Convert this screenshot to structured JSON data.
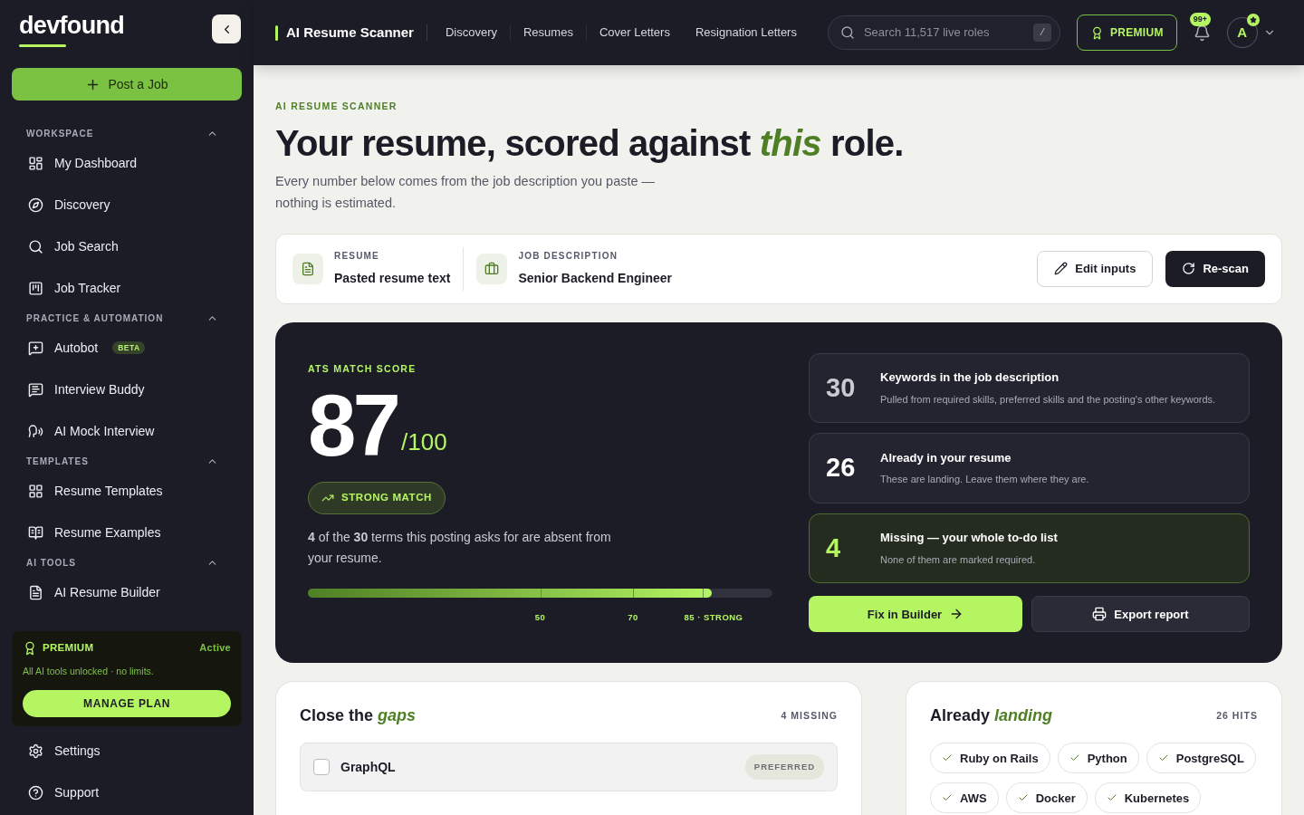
{
  "sidebar": {
    "logo": "devfound",
    "post_button": "Post a Job",
    "sections": [
      {
        "title": "WORKSPACE",
        "expanded": true,
        "items": [
          {
            "label": "My Dashboard"
          },
          {
            "label": "Discovery"
          },
          {
            "label": "Job Search"
          },
          {
            "label": "Job Tracker"
          }
        ]
      },
      {
        "title": "PRACTICE & AUTOMATION",
        "expanded": true,
        "items": [
          {
            "label": "Autobot",
            "badge": "BETA"
          },
          {
            "label": "Interview Buddy"
          },
          {
            "label": "AI Mock Interview"
          }
        ]
      },
      {
        "title": "TEMPLATES",
        "expanded": true,
        "items": [
          {
            "label": "Resume Templates"
          },
          {
            "label": "Resume Examples"
          }
        ]
      },
      {
        "title": "AI TOOLS",
        "expanded": true,
        "items": [
          {
            "label": "AI Resume Builder"
          }
        ]
      }
    ],
    "premium": {
      "title": "PREMIUM",
      "status": "Active",
      "note": "All AI tools unlocked · no limits.",
      "button": "MANAGE PLAN"
    },
    "footer_items": [
      {
        "label": "Settings"
      },
      {
        "label": "Support"
      }
    ]
  },
  "topbar": {
    "title": "AI Resume Scanner",
    "links": [
      "Discovery",
      "Resumes",
      "Cover Letters",
      "Resignation Letters"
    ],
    "search": {
      "placeholder": "Search 11,517 live roles",
      "shortcut": "/"
    },
    "premium_button": "PREMIUM",
    "notifications": "99+",
    "avatar": "A"
  },
  "header": {
    "eyebrow": "AI RESUME SCANNER",
    "title": "Your resume, scored against *this* role.",
    "subtitle": "Every number below comes from the job description you paste — nothing is estimated."
  },
  "inputs": [
    {
      "label": "RESUME",
      "value": "Pasted resume text"
    },
    {
      "label": "JOB DESCRIPTION",
      "value": "Senior Backend Engineer"
    }
  ],
  "input_actions": {
    "edit": "Edit inputs",
    "rescan": "Re-scan"
  },
  "score": {
    "eyebrow": "ATS MATCH SCORE",
    "value": "87",
    "max": "/100",
    "verdict": "STRONG MATCH",
    "summary": "**4** of the **30** terms this posting asks for are absent from your resume.",
    "level": 0.87,
    "ticks": [
      "50",
      "70",
      "85 · STRONG"
    ]
  },
  "stats": [
    {
      "number": "30",
      "title": "Keywords in the job description",
      "text": "Pulled from required skills, preferred skills and the posting's other keywords.",
      "highlighted": false
    },
    {
      "number": "26",
      "title": "Already in your resume",
      "text": "These are landing. Leave them where they are.",
      "highlighted": false
    },
    {
      "number": "4",
      "title": "Missing — your whole to-do list",
      "text": "None of them are marked required.",
      "highlighted": true
    }
  ],
  "score_actions": {
    "fix": "Fix in Builder",
    "export": "Export report"
  },
  "gaps": {
    "title": "Close the *gaps*",
    "count": "4 MISSING",
    "rows": [
      {
        "label": "GraphQL",
        "tag": "PREFERRED",
        "checked": false
      }
    ]
  },
  "landing": {
    "title": "Already *landing*",
    "count": "26 HITS",
    "chips": [
      "Ruby on Rails",
      "Python",
      "PostgreSQL",
      "AWS",
      "Docker",
      "Kubernetes"
    ]
  }
}
